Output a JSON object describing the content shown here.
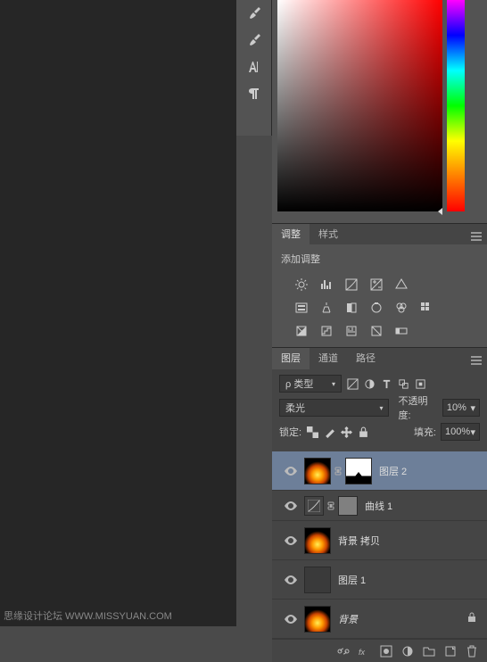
{
  "watermark": "思缘设计论坛 WWW.MISSYUAN.COM",
  "tool_dock": {
    "icons": [
      "brush-icon",
      "history-brush-icon",
      "type-icon",
      "paragraph-icon"
    ]
  },
  "adjustments_panel": {
    "tabs": [
      "调整",
      "样式"
    ],
    "active_tab": 0,
    "title": "添加调整",
    "icons_row1": [
      "brightness-icon",
      "levels-icon",
      "curves-icon",
      "exposure-icon",
      "vibrance-icon"
    ],
    "icons_row2": [
      "hue-sat-icon",
      "color-balance-icon",
      "bw-icon",
      "photo-filter-icon",
      "channel-mixer-icon",
      "color-lookup-icon"
    ],
    "icons_row3": [
      "invert-icon",
      "posterize-icon",
      "threshold-icon",
      "selective-color-icon",
      "gradient-map-icon"
    ]
  },
  "layers_panel": {
    "tabs": [
      "图层",
      "通道",
      "路径"
    ],
    "active_tab": 0,
    "filter_type": "类型",
    "blend_mode": "柔光",
    "opacity_label": "不透明度:",
    "opacity_value": "10%",
    "lock_label": "锁定:",
    "fill_label": "填充:",
    "fill_value": "100%",
    "layers": [
      {
        "name": "图层 2",
        "type": "normal",
        "has_mask": true,
        "selected": true
      },
      {
        "name": "曲线 1",
        "type": "adjustment",
        "has_mask": true
      },
      {
        "name": "背景 拷贝",
        "type": "normal"
      },
      {
        "name": "图层 1",
        "type": "normal",
        "dark": true
      },
      {
        "name": "背景",
        "type": "background",
        "locked": true,
        "italic": true
      }
    ]
  }
}
